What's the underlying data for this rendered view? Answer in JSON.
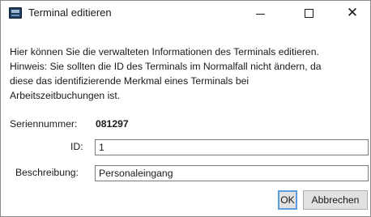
{
  "window": {
    "title": "Terminal editieren"
  },
  "info": {
    "line1": "Hier können Sie die verwalteten Informationen des Terminals editieren.",
    "line2": "Hinweis: Sie sollten die ID des Terminals im Normalfall nicht ändern, da",
    "line3": "diese das identifizierende Merkmal eines Terminals bei",
    "line4": "Arbeitszeitbuchungen ist."
  },
  "serial": {
    "label": "Seriennummer:",
    "value": "081297"
  },
  "id_field": {
    "label": "ID:",
    "value": "1"
  },
  "description_field": {
    "label": "Beschreibung:",
    "value": "Personaleingang"
  },
  "buttons": {
    "ok_label": "OK",
    "cancel_label": "Abbrechen"
  },
  "icons": {
    "app": "terminal-icon",
    "minimize": "minimize-icon",
    "maximize": "maximize-icon",
    "close": "close-icon"
  }
}
